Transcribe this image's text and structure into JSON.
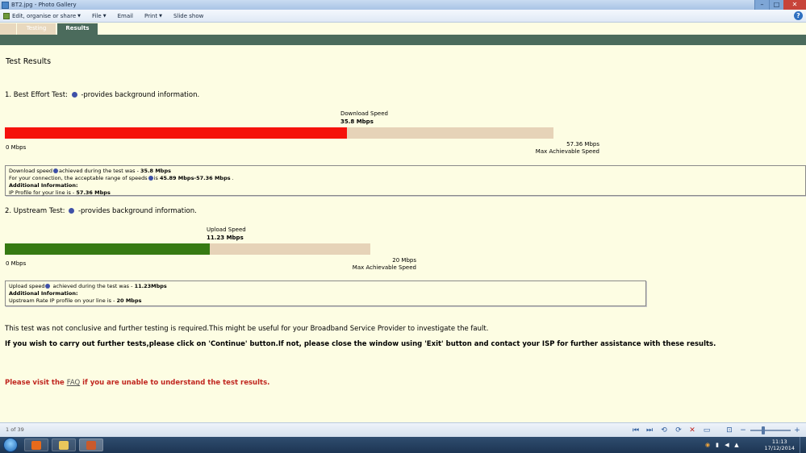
{
  "window": {
    "title": "BT2.jpg - Photo Gallery",
    "icons": {
      "app": "photo-gallery-icon",
      "minimize": "minimize-icon",
      "maximize": "maximize-icon",
      "close": "close-icon"
    },
    "controls": {
      "minimize": "–",
      "maximize": "□",
      "close": "✕"
    }
  },
  "command_bar": {
    "items": [
      {
        "label": "Edit, organise or share",
        "has_menu": true,
        "icon": "edit-share-icon"
      },
      {
        "label": "File",
        "has_menu": true
      },
      {
        "label": "Email",
        "has_menu": false
      },
      {
        "label": "Print",
        "has_menu": true
      },
      {
        "label": "Slide show",
        "has_menu": false
      }
    ],
    "help": "?"
  },
  "tabs": [
    {
      "label": ""
    },
    {
      "label": "Testing"
    },
    {
      "label": "Results",
      "active": true
    }
  ],
  "results": {
    "heading": "Test Results",
    "best_effort": {
      "title": "1. Best Effort Test:",
      "title_suffix": "-provides background information.",
      "speed_caption": "Download Speed",
      "speed_value": "35.8 Mbps",
      "measured": 35.8,
      "max": 57.36,
      "bar_color": "#f5120c",
      "scale_min": "0 Mbps",
      "scale_max": "57.36 Mbps",
      "scale_max_label": "Max Achievable Speed",
      "info_lines": {
        "l1_pre": "Download speed",
        "l1_mid": "achieved during the test was - ",
        "l1_val": "35.8 Mbps",
        "l2_pre": "For your connection, the acceptable range of speeds",
        "l2_mid": "is ",
        "l2_val": "45.89 Mbps-57.36 Mbps",
        "l2_end": " .",
        "l3": "Additional Information:",
        "l4_pre": "IP Profile for your line is - ",
        "l4_val": "57.36 Mbps"
      }
    },
    "upstream": {
      "title": "2. Upstream Test:",
      "title_suffix": "-provides background information.",
      "speed_caption": "Upload Speed",
      "speed_value": "11.23 Mbps",
      "measured": 11.23,
      "max": 20,
      "bar_color": "#367a12",
      "scale_min": "0 Mbps",
      "scale_max": "20 Mbps",
      "scale_max_label": "Max Achievable Speed",
      "info_lines": {
        "l1_pre": "Upload speed",
        "l1_mid": " achieved during the test was - ",
        "l1_val": "11.23Mbps",
        "l2": "Additional Information:",
        "l3_pre": "Upstream Rate IP profile on your line is - ",
        "l3_val": "20 Mbps"
      }
    },
    "message_1": "This test was not conclusive and further testing is required.This might be useful for your Broadband Service Provider to investigate the fault.",
    "message_2": "If you wish to carry out further tests,please click on 'Continue' button.If not, please close the window using 'Exit' button and contact your ISP for further assistance with these results.",
    "faq": {
      "pre": "Please visit the ",
      "link": "FAQ",
      "post": " if you are unable to understand the test results."
    }
  },
  "gallery_bar": {
    "counter": "1 of 39",
    "controls": [
      {
        "icon": "first-icon",
        "glyph": "⏮"
      },
      {
        "icon": "next-icon",
        "glyph": "⏭"
      },
      {
        "icon": "rotate-left-icon",
        "glyph": "⟲"
      },
      {
        "icon": "rotate-right-icon",
        "glyph": "⟳"
      },
      {
        "icon": "delete-icon",
        "glyph": "✕"
      },
      {
        "icon": "play-slideshow-icon",
        "glyph": "▭"
      },
      {
        "icon": "actual-size-icon",
        "glyph": "⊡"
      }
    ],
    "zoom_out": "−",
    "zoom_in": "+"
  },
  "taskbar": {
    "apps": [
      {
        "name": "firefox-icon",
        "color": "#e76a1b"
      },
      {
        "name": "explorer-folder-icon",
        "color": "#e9c75b"
      },
      {
        "name": "photo-gallery-task-icon",
        "color": "#c95a2c"
      }
    ],
    "tray_icons": [
      "shield-icon",
      "network-icon",
      "volume-icon",
      "flag-icon"
    ],
    "tray_glyphs": [
      "◉",
      "▮",
      "◀",
      "▲"
    ],
    "time": "11:13",
    "date": "17/12/2014"
  }
}
